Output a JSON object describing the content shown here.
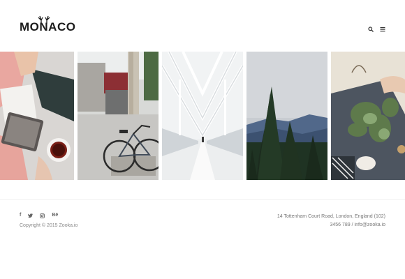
{
  "header": {
    "logo_text": "MONACO",
    "icons": [
      "search-icon",
      "menu-icon"
    ]
  },
  "gallery": {
    "tiles": [
      {
        "name": "gallery-tile-tablet-coffee",
        "subject": "tablet-and-coffee"
      },
      {
        "name": "gallery-tile-bicycle",
        "subject": "bicycle-street"
      },
      {
        "name": "gallery-tile-bridge",
        "subject": "snowy-bridge"
      },
      {
        "name": "gallery-tile-mountains",
        "subject": "forest-mountains"
      },
      {
        "name": "gallery-tile-plants",
        "subject": "plants-wreath"
      }
    ]
  },
  "footer": {
    "social": {
      "facebook": "f",
      "twitter": "twitter-icon",
      "instagram": "instagram-icon",
      "behance": "Bē"
    },
    "copyright": "Copyright © 2015 Zooka.io",
    "address_line1": "14 Tottenham Court Road, London, England (102)",
    "address_line2": "3456 789 / info@zooka.io"
  },
  "colors": {
    "logo": "#1c1c1c",
    "text_muted": "#888888",
    "divider": "#efefef",
    "background": "#ffffff"
  }
}
